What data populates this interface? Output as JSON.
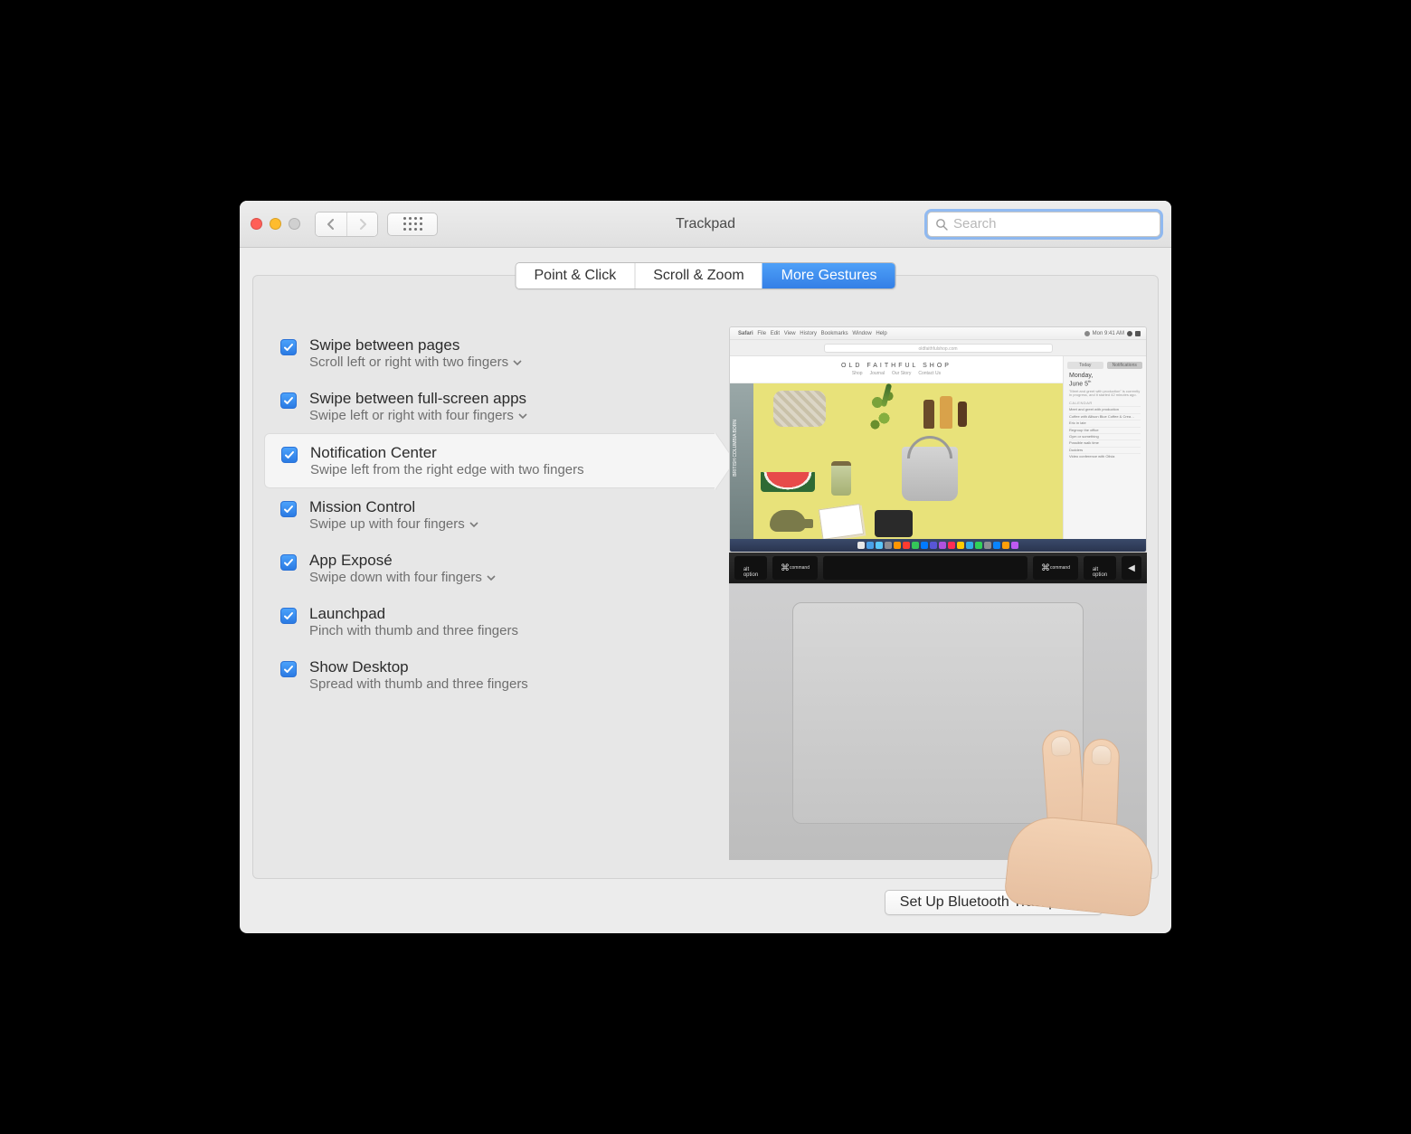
{
  "window": {
    "title": "Trackpad"
  },
  "search": {
    "placeholder": "Search",
    "value": ""
  },
  "tabs": [
    {
      "label": "Point & Click",
      "active": false
    },
    {
      "label": "Scroll & Zoom",
      "active": false
    },
    {
      "label": "More Gestures",
      "active": true
    }
  ],
  "options": [
    {
      "title": "Swipe between pages",
      "subtitle": "Scroll left or right with two fingers",
      "checked": true,
      "has_dropdown": true,
      "selected": false
    },
    {
      "title": "Swipe between full-screen apps",
      "subtitle": "Swipe left or right with four fingers",
      "checked": true,
      "has_dropdown": true,
      "selected": false
    },
    {
      "title": "Notification Center",
      "subtitle": "Swipe left from the right edge with two fingers",
      "checked": true,
      "has_dropdown": false,
      "selected": true
    },
    {
      "title": "Mission Control",
      "subtitle": "Swipe up with four fingers",
      "checked": true,
      "has_dropdown": true,
      "selected": false
    },
    {
      "title": "App Exposé",
      "subtitle": "Swipe down with four fingers",
      "checked": true,
      "has_dropdown": true,
      "selected": false
    },
    {
      "title": "Launchpad",
      "subtitle": "Pinch with thumb and three fingers",
      "checked": true,
      "has_dropdown": false,
      "selected": false
    },
    {
      "title": "Show Desktop",
      "subtitle": "Spread with thumb and three fingers",
      "checked": true,
      "has_dropdown": false,
      "selected": false
    }
  ],
  "preview": {
    "menubar_app": "Safari",
    "menubar_items": [
      "File",
      "Edit",
      "View",
      "History",
      "Bookmarks",
      "Window",
      "Help"
    ],
    "menubar_time": "Mon 9:41 AM",
    "site_url": "oldfaithfulshop.com",
    "site_brand": "OLD FAITHFUL SHOP",
    "site_nav": [
      "Shop",
      "Journal",
      "Our Story",
      "Contact Us"
    ],
    "side_strip_text": "BRITISH COLUMBIA BORN",
    "notification_center": {
      "tabs": [
        "Today",
        "Notifications"
      ],
      "date_line1": "Monday,",
      "date_line2": "June 5",
      "summary": "\"Meet and greet with production\" is currently in progress, and it started 42 minutes ago.",
      "section": "CALENDAR",
      "events": [
        "Meet and greet with production",
        "Coffee with Allison  Blue Coffee & Crea…",
        "Eric in late",
        "Regroup  the office",
        "Gym or something",
        "Possible walk time",
        "Dudders",
        "Video conference with Olivia"
      ]
    }
  },
  "footer": {
    "bluetooth_button": "Set Up Bluetooth Trackpad…",
    "help_label": "?"
  }
}
